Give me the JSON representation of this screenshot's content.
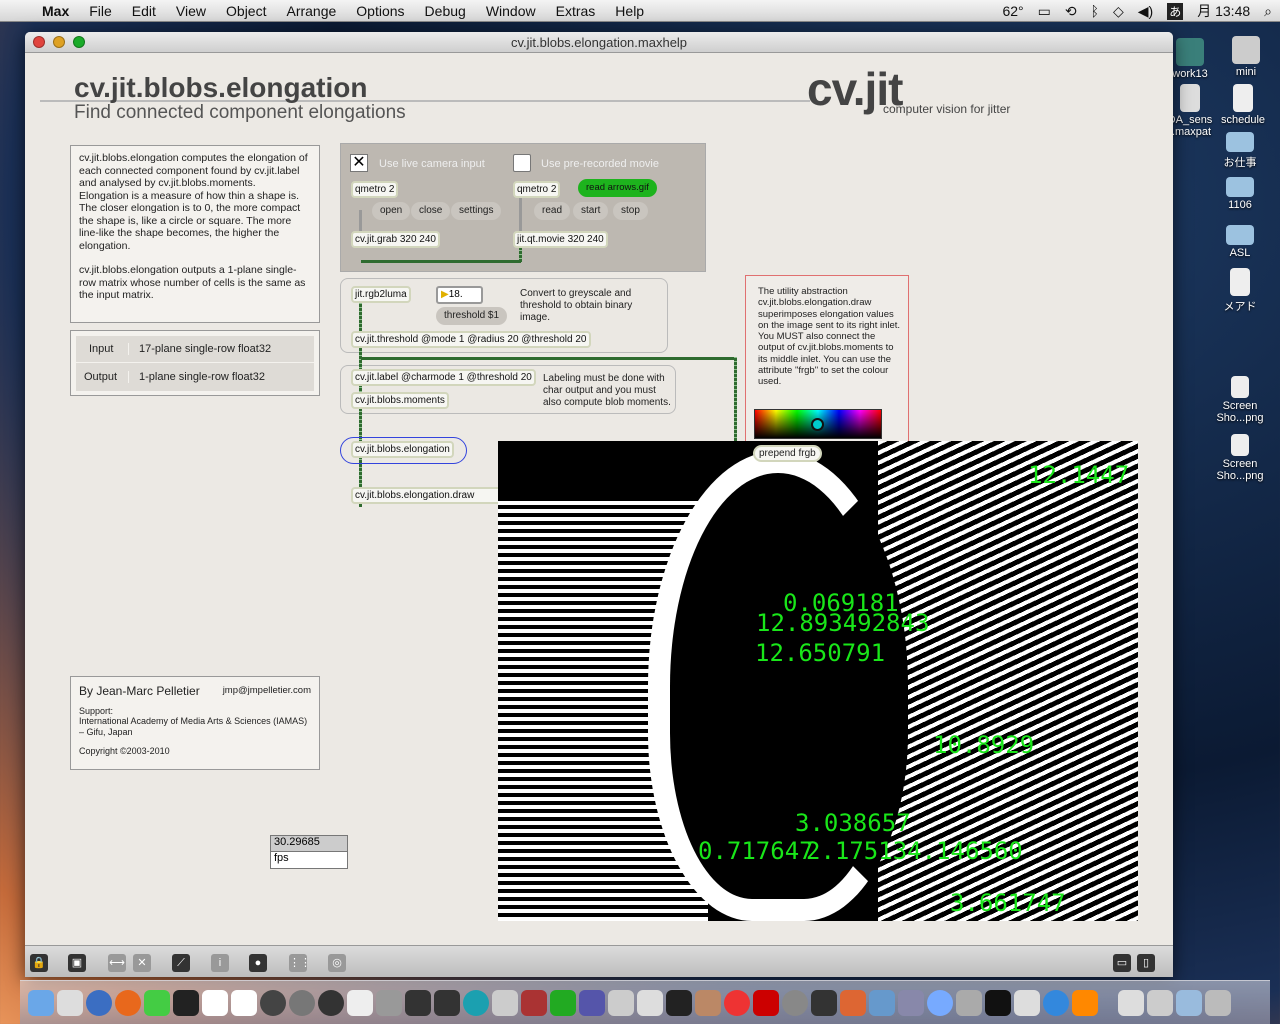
{
  "menubar": {
    "items": [
      "Max",
      "File",
      "Edit",
      "View",
      "Object",
      "Arrange",
      "Options",
      "Debug",
      "Window",
      "Extras",
      "Help"
    ],
    "temp": "62°",
    "input_method": "あ",
    "clock": "月 13:48"
  },
  "window": {
    "title": "cv.jit.blobs.elongation.maxhelp"
  },
  "header": {
    "title": "cv.jit.blobs.elongation",
    "subtitle": "Find connected component elongations",
    "logo": "cv.jit",
    "logo_sub": "computer vision for jitter"
  },
  "description": {
    "p1": "cv.jit.blobs.elongation computes the elongation of each connected component found by cv.jit.label and analysed by cv.jit.blobs.moments.",
    "p2": "Elongation is a measure of how thin a shape is. The closer elongation is to 0, the more compact the shape is, like a circle or square. The more line-like the shape becomes, the higher the elongation.",
    "p3": "cv.jit.blobs.elongation outputs a 1-plane single-row matrix whose number of cells is the same as the input matrix."
  },
  "io": [
    {
      "label": "Input",
      "value": "17-plane single-row float32"
    },
    {
      "label": "Output",
      "value": "1-plane single-row float32"
    }
  ],
  "author": {
    "by": "By Jean-Marc Pelletier",
    "email": "jmp@jmpelletier.com",
    "support": "Support:",
    "org": "International Academy of Media Arts & Sciences (IAMAS) – Gifu, Japan",
    "copyright": "Copyright ©2003-2010"
  },
  "patch": {
    "live_label": "Use live camera input",
    "movie_label": "Use pre-recorded movie",
    "qmetro1": "qmetro 2",
    "qmetro2": "qmetro 2",
    "read_arrows": "read arrows.gif",
    "open": "open",
    "close": "close",
    "settings": "settings",
    "read": "read",
    "start": "start",
    "stop": "stop",
    "grab": "cv.jit.grab 320 240",
    "qtmovie": "jit.qt.movie 320 240",
    "rgb2luma": "jit.rgb2luma",
    "number": "18.",
    "threshold_msg": "threshold $1",
    "convert_comment": "Convert to greyscale and threshold to obtain binary image.",
    "threshold": "cv.jit.threshold @mode 1 @radius 20 @threshold 20",
    "label": "cv.jit.label @charmode 1 @threshold 20",
    "moments": "cv.jit.blobs.moments",
    "label_comment": "Labeling must be done with char output and you must also compute blob moments.",
    "elongation": "cv.jit.blobs.elongation",
    "draw": "cv.jit.blobs.elongation.draw",
    "draw_comment": "The utility abstraction cv.jit.blobs.elongation.draw superimposes elongation values on the image sent to its right inlet. You MUST also connect the output of cv.jit.blobs.moments to its middle inlet. You can use the attribute \"frgb\" to set the colour used.",
    "prepend": "prepend frgb",
    "fps_value": "30.29685",
    "fps_label": "fps",
    "live_checked": true,
    "movie_checked": false
  },
  "video_labels": [
    "0.069181",
    "12.893492843",
    "12.650791",
    "3.038657",
    "0.717647",
    "2.175134.146560",
    "3.661747",
    "12.1447",
    "10.8929"
  ],
  "desktop": [
    "work13",
    "mini",
    "DA_sens r.maxpat",
    "schedule",
    "お仕事",
    "1106",
    "ASL",
    "メアド",
    "Screen Sho...png",
    "Screen Sho...png"
  ],
  "colors": {
    "accent_green": "#19e619",
    "wire": "#2f6b2f",
    "msg_green": "#1db31d"
  }
}
